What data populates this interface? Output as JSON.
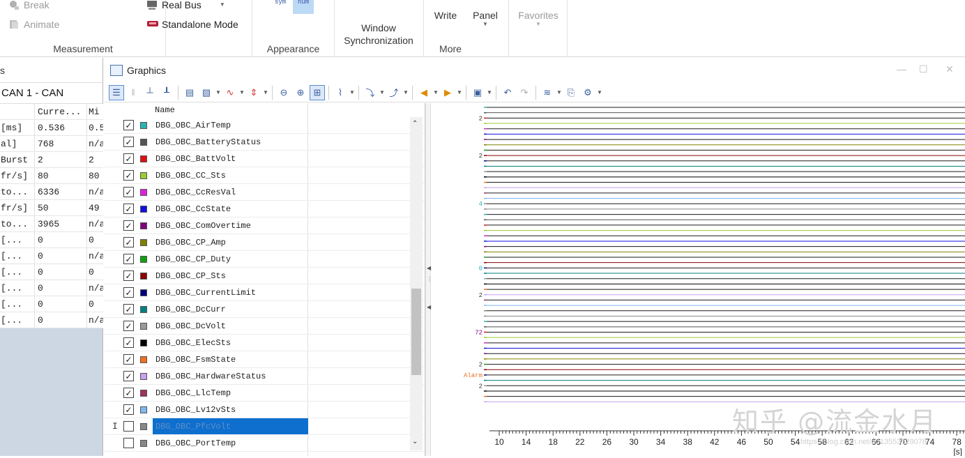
{
  "ribbon": {
    "measurement": {
      "label": "Measurement",
      "break_label": "Break",
      "animate_label": "Animate",
      "real_bus_label": "Real Bus",
      "standalone_label": "Standalone Mode"
    },
    "appearance": {
      "label": "Appearance",
      "sym_label": "sym",
      "num_label": "num"
    },
    "window_sync_label": "Window\nSynchronization",
    "more": {
      "label": "More",
      "write_label": "Write",
      "panel_label": "Panel"
    },
    "favorites_label": "Favorites"
  },
  "left_panel": {
    "title": "s",
    "subtitle": "CAN 1 - CAN",
    "columns": [
      "",
      "Curre...",
      "Mi"
    ],
    "rows": [
      [
        "[ms]",
        "0.536",
        "0.5"
      ],
      [
        "al]",
        "768",
        "n/a"
      ],
      [
        "Burst",
        "2",
        "2"
      ],
      [
        "fr/s]",
        "80",
        "80"
      ],
      [
        "to...",
        "6336",
        "n/a"
      ],
      [
        "fr/s]",
        "50",
        "49"
      ],
      [
        "to...",
        "3965",
        "n/a"
      ],
      [
        " [...",
        "0",
        "0"
      ],
      [
        " [...",
        "0",
        "n/a"
      ],
      [
        " [...",
        "0",
        "0"
      ],
      [
        " [...",
        "0",
        "n/a"
      ],
      [
        " [...",
        "0",
        "0"
      ],
      [
        " [...",
        "0",
        "n/a"
      ]
    ]
  },
  "graphics": {
    "title": "Graphics",
    "list_header": "Name",
    "signals": [
      {
        "name": "DBG_OBC_AirTemp",
        "checked": true,
        "color": "#2ab3b3"
      },
      {
        "name": "DBG_OBC_BatteryStatus",
        "checked": true,
        "color": "#555555"
      },
      {
        "name": "DBG_OBC_BattVolt",
        "checked": true,
        "color": "#e01010"
      },
      {
        "name": "DBG_OBC_CC_Sts",
        "checked": true,
        "color": "#9acd32"
      },
      {
        "name": "DBG_OBC_CcResVal",
        "checked": true,
        "color": "#e020e0"
      },
      {
        "name": "DBG_OBC_CcState",
        "checked": true,
        "color": "#1010e0"
      },
      {
        "name": "DBG_OBC_ComOvertime",
        "checked": true,
        "color": "#800080"
      },
      {
        "name": "DBG_OBC_CP_Amp",
        "checked": true,
        "color": "#808000"
      },
      {
        "name": "DBG_OBC_CP_Duty",
        "checked": true,
        "color": "#10a010"
      },
      {
        "name": "DBG_OBC_CP_Sts",
        "checked": true,
        "color": "#8b0000"
      },
      {
        "name": "DBG_OBC_CurrentLimit",
        "checked": true,
        "color": "#000080"
      },
      {
        "name": "DBG_OBC_DcCurr",
        "checked": true,
        "color": "#008080"
      },
      {
        "name": "DBG_OBC_DcVolt",
        "checked": true,
        "color": "#999999"
      },
      {
        "name": "DBG_OBC_ElecSts",
        "checked": true,
        "color": "#000000"
      },
      {
        "name": "DBG_OBC_FsmState",
        "checked": true,
        "color": "#f07020"
      },
      {
        "name": "DBG_OBC_HardwareStatus",
        "checked": true,
        "color": "#c8a0f0"
      },
      {
        "name": "DBG_OBC_LlcTemp",
        "checked": true,
        "color": "#a03060"
      },
      {
        "name": "DBG_OBC_Lv12vSts",
        "checked": true,
        "color": "#80b8f0"
      },
      {
        "name": "DBG_OBC_PfcVolt",
        "checked": false,
        "color": "#888888",
        "selected": true
      },
      {
        "name": "DBG_OBC_PortTemp",
        "checked": false,
        "color": "#888888"
      }
    ],
    "x_axis": {
      "ticks": [
        "10",
        "14",
        "18",
        "22",
        "26",
        "30",
        "34",
        "38",
        "42",
        "46",
        "50",
        "54",
        "58",
        "62",
        "66",
        "70",
        "74",
        "78"
      ],
      "unit": "[s]"
    },
    "axis_value_labels": [
      "2",
      "2",
      "4",
      "0",
      "2",
      "72",
      "2",
      "2",
      "Alarm"
    ]
  },
  "watermark": "知乎 @流金水月",
  "watermark_url": "https://blog.csdn.net/u013553529078"
}
